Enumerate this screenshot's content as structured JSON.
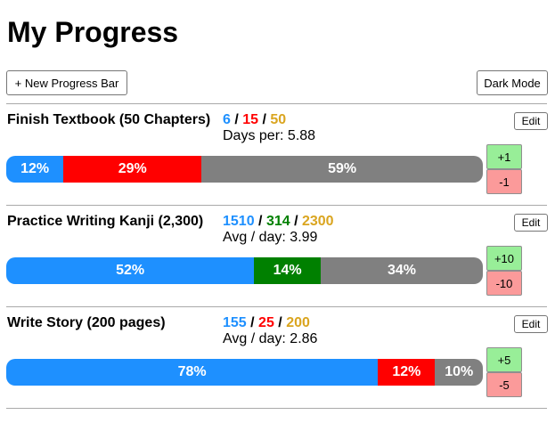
{
  "page": {
    "title": "My Progress"
  },
  "toolbar": {
    "new_label": "+ New Progress Bar",
    "dark_label": "Dark Mode"
  },
  "colors": {
    "done": "#1e90ff",
    "remaining": "#808080",
    "plus_bg": "#98ee98",
    "minus_bg": "#fb9a9a"
  },
  "items": [
    {
      "name": "Finish Textbook (50 Chapters)",
      "done": "6",
      "mid": "15",
      "total": "50",
      "mid_color": "#ff0000",
      "total_color": "#daa520",
      "rate_text": "Days per: 5.88",
      "edit_label": "Edit",
      "segments": [
        {
          "label": "12%",
          "fraction": 0.12,
          "color": "#1e90ff"
        },
        {
          "label": "29%",
          "fraction": 0.29,
          "color": "#ff0000"
        },
        {
          "label": "59%",
          "fraction": 0.59,
          "color": "#808080"
        }
      ],
      "plus_label": "+1",
      "minus_label": "-1"
    },
    {
      "name": "Practice Writing Kanji (2,300)",
      "done": "1510",
      "mid": "314",
      "total": "2300",
      "mid_color": "#008000",
      "total_color": "#daa520",
      "rate_text": "Avg / day: 3.99",
      "edit_label": "Edit",
      "segments": [
        {
          "label": "52%",
          "fraction": 0.52,
          "color": "#1e90ff"
        },
        {
          "label": "14%",
          "fraction": 0.14,
          "color": "#008000"
        },
        {
          "label": "34%",
          "fraction": 0.34,
          "color": "#808080"
        }
      ],
      "plus_label": "+10",
      "minus_label": "-10"
    },
    {
      "name": "Write Story (200 pages)",
      "done": "155",
      "mid": "25",
      "total": "200",
      "mid_color": "#ff0000",
      "total_color": "#daa520",
      "rate_text": "Avg / day: 2.86",
      "edit_label": "Edit",
      "segments": [
        {
          "label": "78%",
          "fraction": 0.78,
          "color": "#1e90ff"
        },
        {
          "label": "12%",
          "fraction": 0.12,
          "color": "#ff0000"
        },
        {
          "label": "10%",
          "fraction": 0.1,
          "color": "#808080"
        }
      ],
      "plus_label": "+5",
      "minus_label": "-5"
    }
  ]
}
